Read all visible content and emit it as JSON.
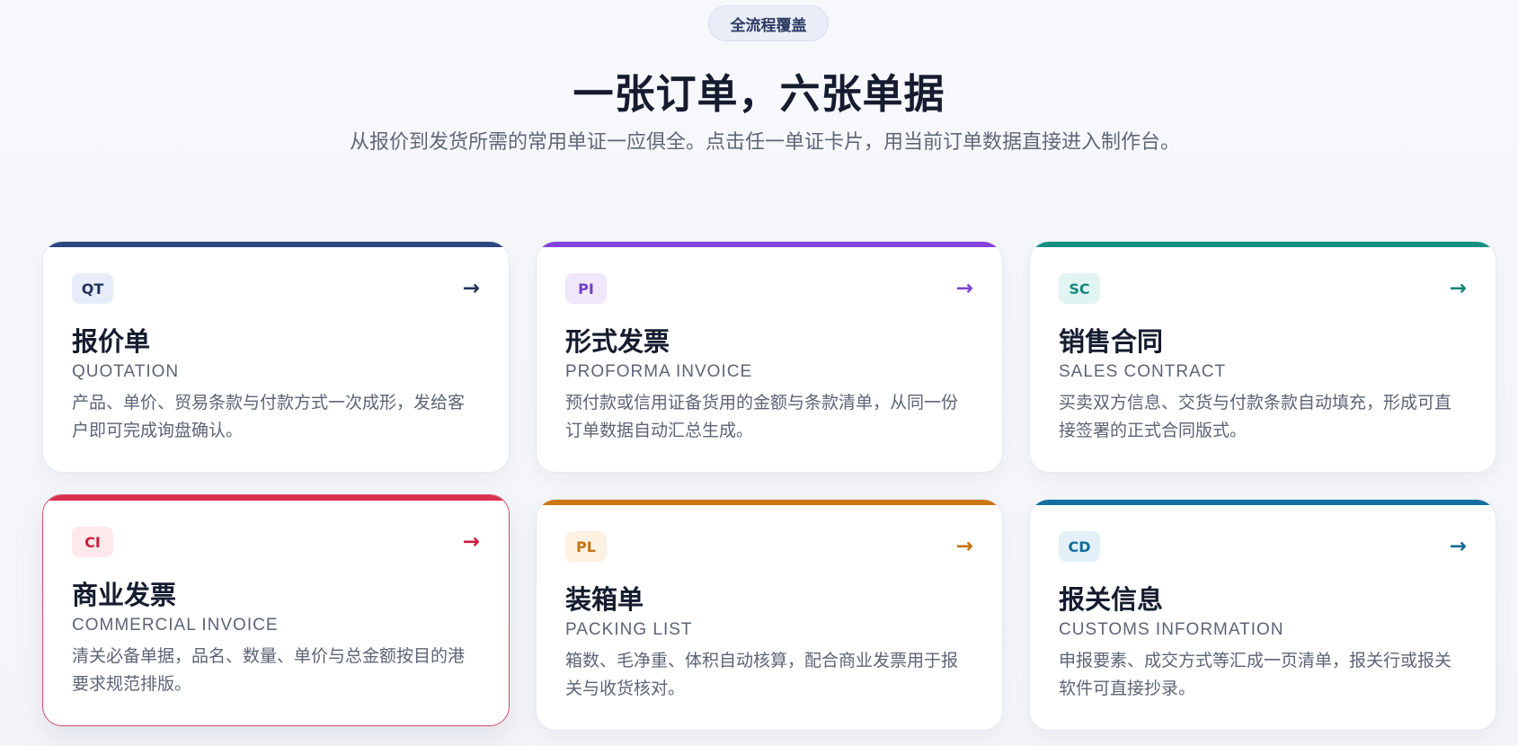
{
  "hero": {
    "pill": "全流程覆盖",
    "title": "一张订单，六张单据",
    "subtitle": "从报价到发货所需的常用单证一应俱全。点击任一单证卡片，用当前订单数据直接进入制作台。"
  },
  "cards": [
    {
      "code": "QT",
      "title": "报价单",
      "en": "QUOTATION",
      "desc": "产品、单价、贸易条款与付款方式一次成形，发给客户即可完成询盘确认。",
      "arrow": "→",
      "accent": "#2e4680"
    },
    {
      "code": "PI",
      "title": "形式发票",
      "en": "PROFORMA INVOICE",
      "desc": "预付款或信用证备货用的金额与条款清单，从同一份订单数据自动汇总生成。",
      "arrow": "→",
      "accent": "#8443dc"
    },
    {
      "code": "SC",
      "title": "销售合同",
      "en": "SALES CONTRACT",
      "desc": "买卖双方信息、交货与付款条款自动填充，形成可直接签署的正式合同版式。",
      "arrow": "→",
      "accent": "#139083"
    },
    {
      "code": "CI",
      "title": "商业发票",
      "en": "COMMERCIAL INVOICE",
      "desc": "清关必备单据，品名、数量、单价与总金额按目的港要求规范排版。",
      "arrow": "→",
      "accent": "#d8304e"
    },
    {
      "code": "PL",
      "title": "装箱单",
      "en": "PACKING LIST",
      "desc": "箱数、毛净重、体积自动核算，配合商业发票用于报关与收货核对。",
      "arrow": "→",
      "accent": "#cb7712"
    },
    {
      "code": "CD",
      "title": "报关信息",
      "en": "CUSTOMS INFORMATION",
      "desc": "申报要素、成交方式等汇成一页清单，报关行或报关软件可直接抄录。",
      "arrow": "→",
      "accent": "#136d9f"
    }
  ]
}
